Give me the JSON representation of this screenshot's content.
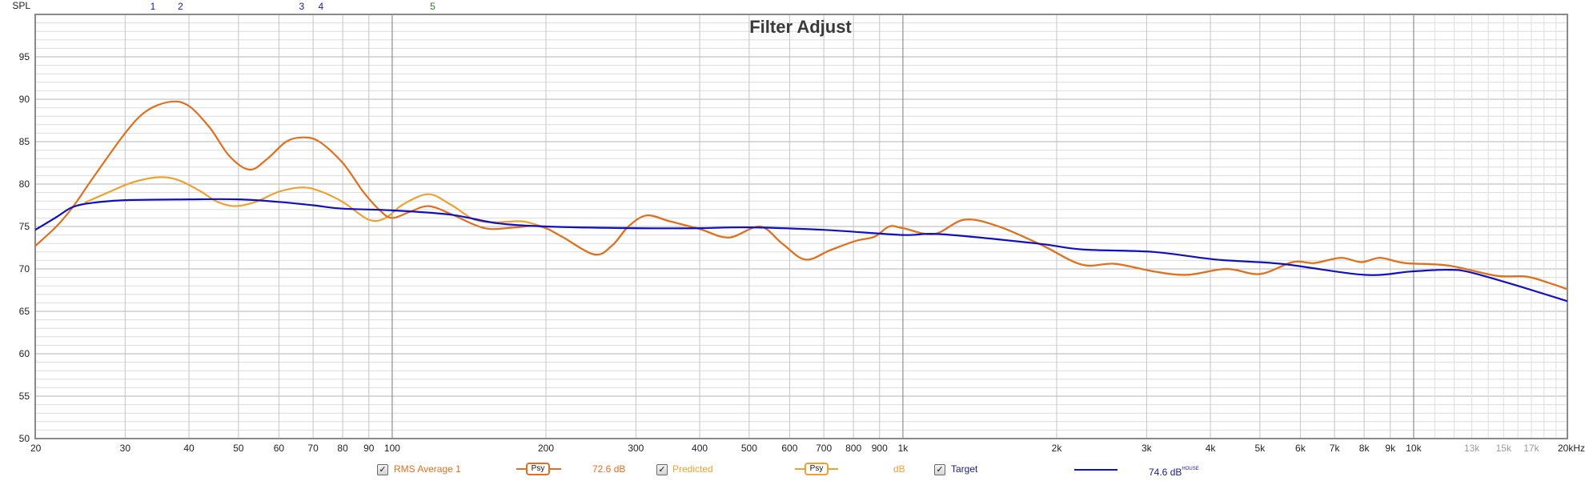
{
  "chart_data": {
    "type": "line",
    "title": "Filter Adjust",
    "ylabel": "SPL",
    "xlabel": "",
    "xscale": "log",
    "xlim": [
      20,
      20000
    ],
    "ylim": [
      50,
      100
    ],
    "grid": true,
    "yticks": [
      50,
      55,
      60,
      65,
      70,
      75,
      80,
      85,
      90,
      95
    ],
    "xticks": [
      {
        "v": 20,
        "label": "20",
        "dim": false
      },
      {
        "v": 30,
        "label": "30",
        "dim": false
      },
      {
        "v": 40,
        "label": "40",
        "dim": false
      },
      {
        "v": 50,
        "label": "50",
        "dim": false
      },
      {
        "v": 60,
        "label": "60",
        "dim": false
      },
      {
        "v": 70,
        "label": "70",
        "dim": false
      },
      {
        "v": 80,
        "label": "80",
        "dim": false
      },
      {
        "v": 90,
        "label": "90",
        "dim": false
      },
      {
        "v": 100,
        "label": "100",
        "dim": false
      },
      {
        "v": 200,
        "label": "200",
        "dim": false
      },
      {
        "v": 300,
        "label": "300",
        "dim": false
      },
      {
        "v": 400,
        "label": "400",
        "dim": false
      },
      {
        "v": 500,
        "label": "500",
        "dim": false
      },
      {
        "v": 600,
        "label": "600",
        "dim": false
      },
      {
        "v": 700,
        "label": "700",
        "dim": false
      },
      {
        "v": 800,
        "label": "800",
        "dim": false
      },
      {
        "v": 900,
        "label": "900",
        "dim": false
      },
      {
        "v": 1000,
        "label": "1k",
        "dim": false
      },
      {
        "v": 2000,
        "label": "2k",
        "dim": false
      },
      {
        "v": 3000,
        "label": "3k",
        "dim": false
      },
      {
        "v": 4000,
        "label": "4k",
        "dim": false
      },
      {
        "v": 5000,
        "label": "5k",
        "dim": false
      },
      {
        "v": 6000,
        "label": "6k",
        "dim": false
      },
      {
        "v": 7000,
        "label": "7k",
        "dim": false
      },
      {
        "v": 8000,
        "label": "8k",
        "dim": false
      },
      {
        "v": 9000,
        "label": "9k",
        "dim": false
      },
      {
        "v": 10000,
        "label": "10k",
        "dim": false
      },
      {
        "v": 13000,
        "label": "13k",
        "dim": true
      },
      {
        "v": 15000,
        "label": "15k",
        "dim": true
      },
      {
        "v": 17000,
        "label": "17k",
        "dim": true
      },
      {
        "v": 20000,
        "label": "20kHz",
        "dim": false
      }
    ],
    "filter_markers": [
      {
        "label": "1",
        "freq": 34,
        "color": "#1a1aa0"
      },
      {
        "label": "2",
        "freq": 38.5,
        "color": "#1a1aa0"
      },
      {
        "label": "3",
        "freq": 66.5,
        "color": "#1a1aa0"
      },
      {
        "label": "4",
        "freq": 72.5,
        "color": "#1a1aa0"
      },
      {
        "label": "5",
        "freq": 120,
        "color": "#2a7a2a"
      }
    ],
    "series": [
      {
        "name": "RMS Average 1",
        "color": "#e07020",
        "points": [
          [
            20,
            72.7
          ],
          [
            22,
            75.0
          ],
          [
            23.7,
            77.3
          ],
          [
            26,
            80.8
          ],
          [
            30,
            86.0
          ],
          [
            33,
            88.6
          ],
          [
            36.8,
            89.7
          ],
          [
            40,
            89.2
          ],
          [
            44,
            86.6
          ],
          [
            48,
            83.3
          ],
          [
            52.6,
            81.7
          ],
          [
            57,
            83.0
          ],
          [
            62,
            85.0
          ],
          [
            66.8,
            85.5
          ],
          [
            72,
            85.0
          ],
          [
            80,
            82.5
          ],
          [
            88,
            79.0
          ],
          [
            95,
            76.8
          ],
          [
            100,
            76.0
          ],
          [
            108,
            76.7
          ],
          [
            117.7,
            77.4
          ],
          [
            130,
            76.5
          ],
          [
            145,
            75.2
          ],
          [
            156,
            74.7
          ],
          [
            175,
            74.9
          ],
          [
            195,
            75.0
          ],
          [
            215,
            73.8
          ],
          [
            249,
            71.7
          ],
          [
            270,
            72.8
          ],
          [
            290,
            75.0
          ],
          [
            315,
            76.3
          ],
          [
            350,
            75.6
          ],
          [
            400,
            74.7
          ],
          [
            456,
            73.7
          ],
          [
            525,
            75.0
          ],
          [
            580,
            73.0
          ],
          [
            644,
            71.1
          ],
          [
            720,
            72.2
          ],
          [
            808,
            73.3
          ],
          [
            880,
            73.8
          ],
          [
            940,
            75.0
          ],
          [
            1000,
            74.8
          ],
          [
            1150,
            74.1
          ],
          [
            1320,
            75.8
          ],
          [
            1540,
            75.0
          ],
          [
            1870,
            72.8
          ],
          [
            2240,
            70.5
          ],
          [
            2600,
            70.6
          ],
          [
            3100,
            69.7
          ],
          [
            3600,
            69.3
          ],
          [
            4300,
            70.0
          ],
          [
            5000,
            69.4
          ],
          [
            5800,
            70.8
          ],
          [
            6400,
            70.7
          ],
          [
            7200,
            71.3
          ],
          [
            7900,
            70.8
          ],
          [
            8600,
            71.3
          ],
          [
            9600,
            70.7
          ],
          [
            11700,
            70.4
          ],
          [
            14500,
            69.2
          ],
          [
            16600,
            69.1
          ],
          [
            18300,
            68.4
          ],
          [
            20000,
            67.6
          ]
        ]
      },
      {
        "name": "Predicted",
        "color": "#f0a030",
        "points": [
          [
            25,
            77.8
          ],
          [
            28,
            79.1
          ],
          [
            31,
            80.2
          ],
          [
            34.8,
            80.8
          ],
          [
            38,
            80.5
          ],
          [
            42,
            79.2
          ],
          [
            45.5,
            77.9
          ],
          [
            49.2,
            77.4
          ],
          [
            54,
            77.9
          ],
          [
            60,
            79.1
          ],
          [
            66.5,
            79.6
          ],
          [
            72,
            79.2
          ],
          [
            80,
            77.9
          ],
          [
            90,
            75.8
          ],
          [
            97,
            76.0
          ],
          [
            105,
            77.6
          ],
          [
            117.7,
            78.8
          ],
          [
            130,
            77.6
          ],
          [
            145,
            75.8
          ],
          [
            160,
            75.5
          ],
          [
            180,
            75.6
          ],
          [
            200,
            74.8
          ],
          [
            215,
            73.8
          ],
          [
            249,
            71.7
          ],
          [
            270,
            72.8
          ],
          [
            290,
            75.0
          ],
          [
            315,
            76.3
          ],
          [
            350,
            75.6
          ],
          [
            400,
            74.7
          ],
          [
            456,
            73.7
          ],
          [
            525,
            75.0
          ],
          [
            580,
            73.0
          ],
          [
            644,
            71.1
          ],
          [
            720,
            72.2
          ],
          [
            808,
            73.3
          ],
          [
            880,
            73.8
          ],
          [
            940,
            75.0
          ],
          [
            1000,
            74.8
          ],
          [
            1150,
            74.1
          ],
          [
            1320,
            75.8
          ],
          [
            1540,
            75.0
          ],
          [
            1870,
            72.8
          ],
          [
            2240,
            70.5
          ],
          [
            2600,
            70.6
          ],
          [
            3100,
            69.7
          ],
          [
            3600,
            69.3
          ],
          [
            4300,
            70.0
          ],
          [
            5000,
            69.4
          ],
          [
            5800,
            70.8
          ],
          [
            6400,
            70.7
          ],
          [
            7200,
            71.3
          ],
          [
            7900,
            70.8
          ],
          [
            8600,
            71.3
          ],
          [
            9600,
            70.7
          ],
          [
            11700,
            70.4
          ],
          [
            14500,
            69.2
          ],
          [
            16600,
            69.1
          ],
          [
            18300,
            68.4
          ],
          [
            20000,
            67.6
          ]
        ]
      },
      {
        "name": "Target",
        "color": "#1010c0",
        "points": [
          [
            20,
            74.6
          ],
          [
            22,
            76.1
          ],
          [
            23.7,
            77.3
          ],
          [
            26,
            77.8
          ],
          [
            30,
            78.1
          ],
          [
            40,
            78.2
          ],
          [
            50,
            78.2
          ],
          [
            60,
            77.9
          ],
          [
            70,
            77.5
          ],
          [
            80,
            77.1
          ],
          [
            100,
            76.9
          ],
          [
            130,
            76.4
          ],
          [
            160,
            75.4
          ],
          [
            200,
            75.0
          ],
          [
            300,
            74.8
          ],
          [
            400,
            74.8
          ],
          [
            500,
            74.9
          ],
          [
            700,
            74.6
          ],
          [
            1000,
            74.0
          ],
          [
            1180,
            74.1
          ],
          [
            1830,
            73.0
          ],
          [
            2240,
            72.3
          ],
          [
            3100,
            72.0
          ],
          [
            4100,
            71.1
          ],
          [
            5500,
            70.6
          ],
          [
            8000,
            69.3
          ],
          [
            9900,
            69.7
          ],
          [
            11700,
            69.9
          ],
          [
            12900,
            69.6
          ],
          [
            16000,
            68.0
          ],
          [
            20000,
            66.2
          ]
        ]
      }
    ]
  },
  "legend": {
    "items": [
      {
        "label": "RMS Average 1",
        "checked": true,
        "psy_label": "Psy",
        "value": "72.6 dB",
        "color": "#e07020"
      },
      {
        "label": "Predicted",
        "checked": true,
        "psy_label": "Psy",
        "value": "dB",
        "color": "#f0a030"
      },
      {
        "label": "Target",
        "checked": true,
        "value": "74.6 dB",
        "value_sup": "HOUSE",
        "color": "#1010c0"
      }
    ],
    "check_glyph": "✓"
  }
}
